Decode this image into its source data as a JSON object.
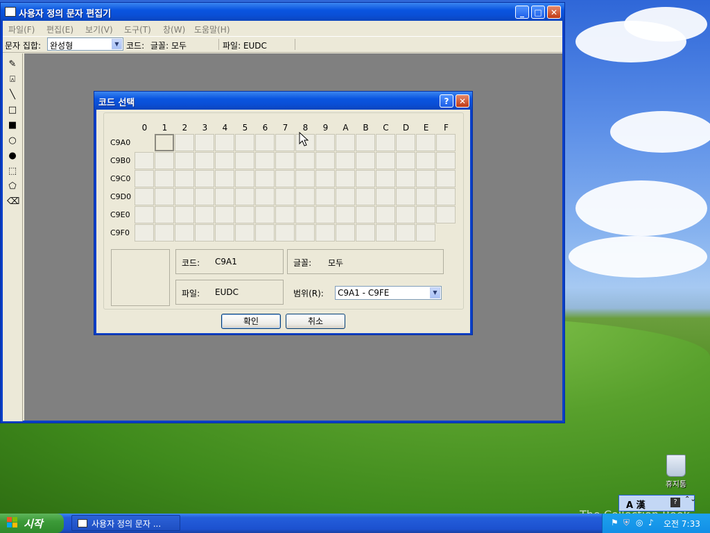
{
  "window": {
    "title": "사용자 정의 문자 편집기",
    "buttons": {
      "minimize": "_",
      "maximize": "□",
      "close": "✕"
    }
  },
  "menu": [
    "파일(F)",
    "편집(E)",
    "보기(V)",
    "도구(T)",
    "창(W)",
    "도움말(H)"
  ],
  "toolbar": {
    "charset_label": "문자 집합:",
    "charset_value": "완성형",
    "code_label": "코드:",
    "font_label": "글꼴: 모두",
    "file_label": "파일: EUDC"
  },
  "tools": [
    "pencil-icon",
    "brush-icon",
    "line-icon",
    "hollow-rectangle-icon",
    "filled-rectangle-icon",
    "hollow-ellipse-icon",
    "filled-ellipse-icon",
    "rect-select-icon",
    "freeform-select-icon",
    "eraser-icon"
  ],
  "dialog": {
    "title": "코드 선택",
    "help_button": "?",
    "close_button": "✕",
    "columns": [
      "0",
      "1",
      "2",
      "3",
      "4",
      "5",
      "6",
      "7",
      "8",
      "9",
      "A",
      "B",
      "C",
      "D",
      "E",
      "F"
    ],
    "rows": [
      "C9A0",
      "C9B0",
      "C9C0",
      "C9D0",
      "C9E0",
      "C9F0"
    ],
    "code_label": "코드:",
    "code_value": "C9A1",
    "font_label": "글꼴:",
    "font_value": "모두",
    "file_label": "파일:",
    "file_value": "EUDC",
    "range_label": "범위(R):",
    "range_value": "C9A1 - C9FE",
    "ok": "확인",
    "cancel": "취소"
  },
  "taskbar": {
    "start": "시작",
    "task_title": "사용자 정의 문자 ...",
    "time": "오전 7:33"
  },
  "desktop": {
    "recycle_bin": "휴지통",
    "watermark": "The Collection Book",
    "langbar": "A 漢"
  }
}
